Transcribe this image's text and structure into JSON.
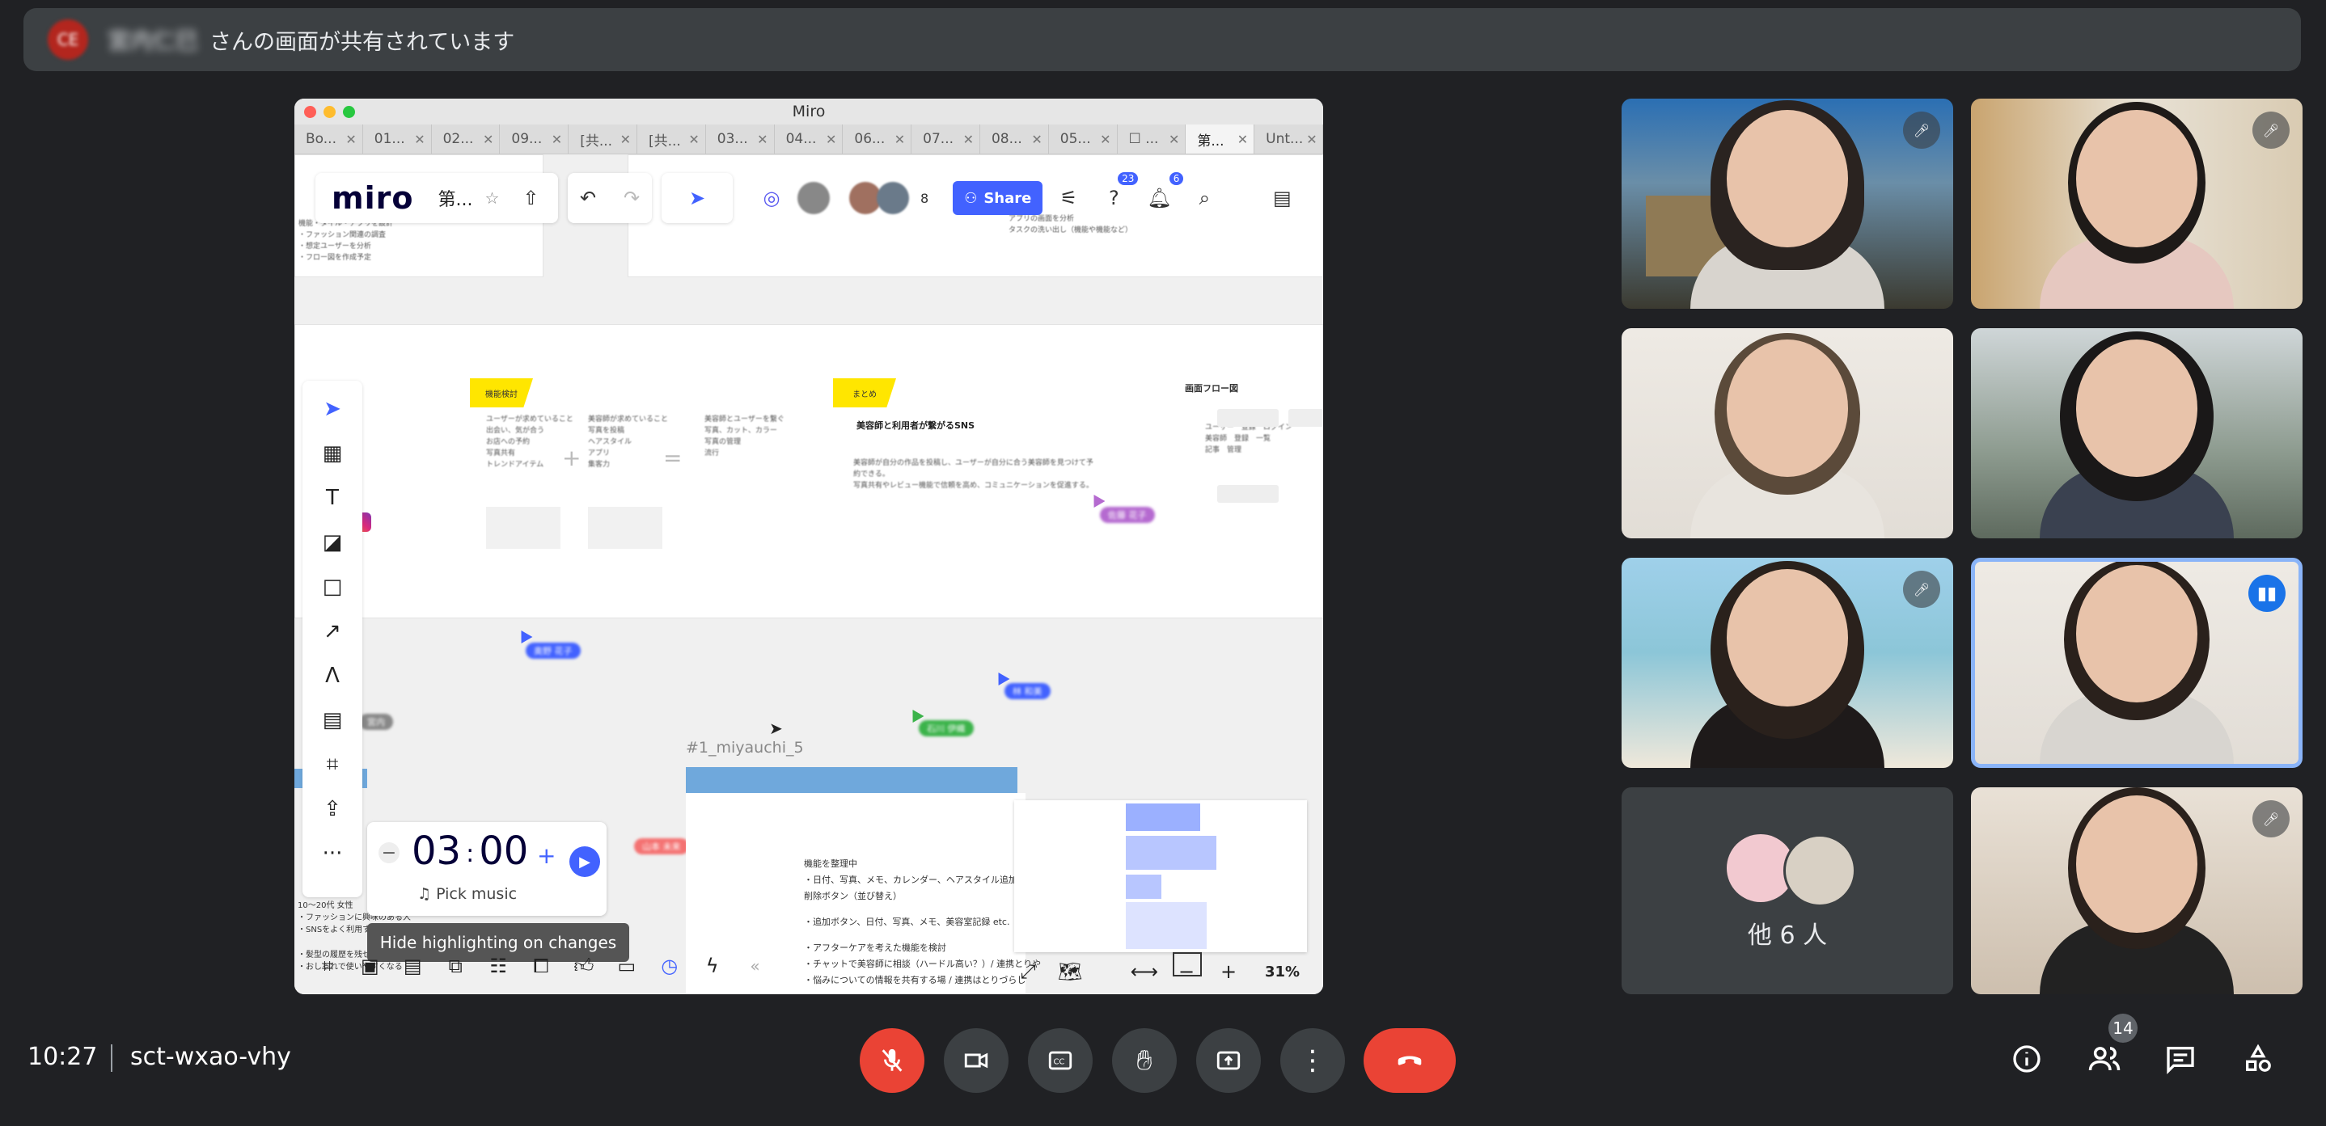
{
  "banner": {
    "presenter_initials": "CE",
    "presenter_name": "宮内仁巳",
    "message": "さんの画面が共有されています"
  },
  "screen": {
    "window_title": "Miro",
    "tabs": [
      "Bo...",
      "01...",
      "02...",
      "09...",
      "[共...",
      "[共...",
      "03...",
      "04...",
      "06...",
      "07...",
      "08...",
      "05...",
      "☐ ...",
      "第...",
      "Unt..."
    ],
    "active_tab_index": 13,
    "toolbar": {
      "logo": "miro",
      "board_name": "第...",
      "collaborator_count": "8",
      "share_label": "Share",
      "help_badge": "23",
      "notif_badge": "6"
    },
    "canvas": {
      "stickies": [
        "機能検討",
        "まとめ"
      ],
      "frame_label": "画面フロー図",
      "section_heading": "#1_miyauchi_5",
      "summary_title": "美容師と利用者が繋がるSNS",
      "detail_lines": [
        "機能を整理中",
        "・日付、写真、メモ、カレンダー、ヘアスタイル追加",
        "削除ボタン（並び替え）",
        "・追加ボタン、日付、写真、メモ、美容室記録 etc.",
        "・アフターケアを考えた機能を検討",
        "・チャットで美容師に相談（ハードル高い？）/ 連携とりや",
        "・悩みについての情報を共有する場 / 連携はとりづらし"
      ],
      "left_lines": [
        "10～20代 女性",
        "・ファッションに興味のある人",
        "・SNSをよく利用する人",
        "・髪型の履歴を残せる",
        "・おしゃれで使いやすくなる"
      ]
    },
    "timer": {
      "minutes": "03",
      "seconds": "00",
      "music_label": "Pick music"
    },
    "tooltip": "Hide highlighting on changes",
    "zoom": "31%"
  },
  "participants": {
    "others_label": "他 6 人"
  },
  "controls": {
    "time": "10:27",
    "meeting_code": "sct-wxao-vhy",
    "people_count": "14"
  }
}
